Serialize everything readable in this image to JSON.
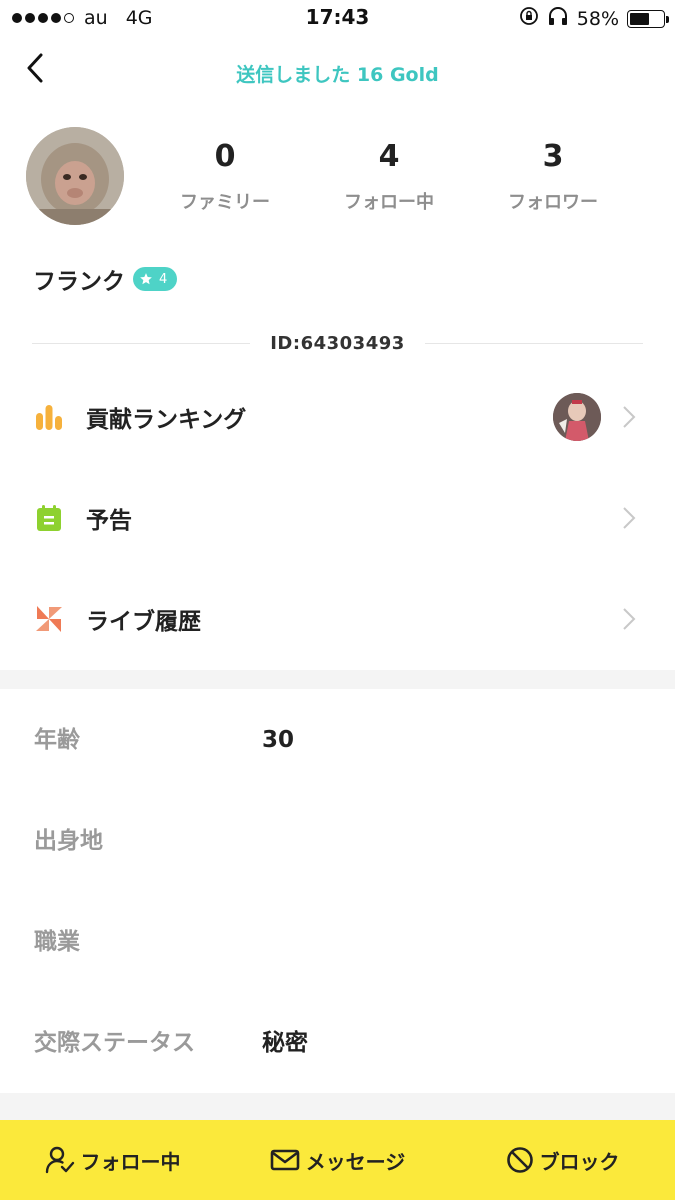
{
  "status_bar": {
    "carrier": "au",
    "network": "4G",
    "time": "17:43",
    "battery": "58%",
    "battery_level": 0.58
  },
  "nav": {
    "title": "送信しました 16 Gold"
  },
  "profile": {
    "stats": [
      {
        "value": "0",
        "label": "ファミリー"
      },
      {
        "value": "4",
        "label": "フォロー中"
      },
      {
        "value": "3",
        "label": "フォロワー"
      }
    ],
    "username": "フランク",
    "level": "4",
    "id_text": "ID:64303493"
  },
  "menu": [
    {
      "label": "貢献ランキング",
      "icon": "bar-chart-icon"
    },
    {
      "label": "予告",
      "icon": "calendar-icon"
    },
    {
      "label": "ライブ履歴",
      "icon": "pinwheel-icon"
    }
  ],
  "info": [
    {
      "label": "年齢",
      "value": "30"
    },
    {
      "label": "出身地",
      "value": ""
    },
    {
      "label": "職業",
      "value": ""
    },
    {
      "label": "交際ステータス",
      "value": "秘密"
    }
  ],
  "bottom_bar": {
    "follow": "フォロー中",
    "message": "メッセージ",
    "block": "ブロック"
  },
  "colors": {
    "accent_teal": "#3ec6c0",
    "bottom_bar": "#fbe93b",
    "menu_orange": "#f6b13c",
    "menu_green": "#8ed12f",
    "menu_coral": "#ef7a55"
  }
}
